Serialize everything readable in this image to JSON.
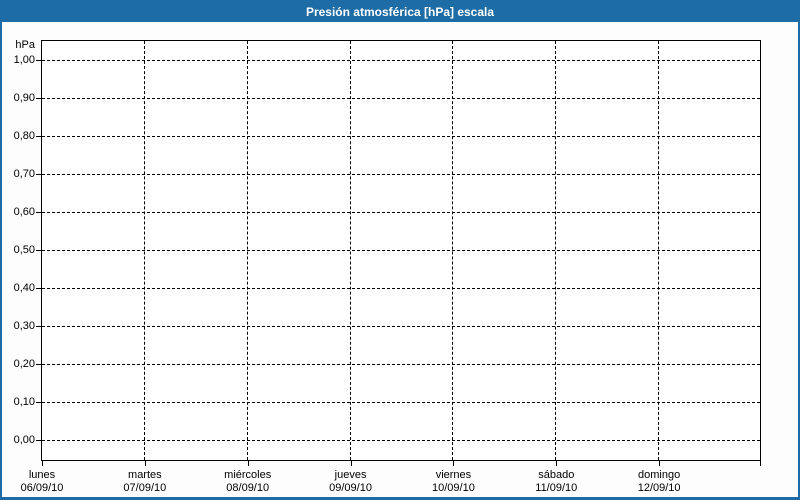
{
  "window": {
    "title": "Presión atmosférica [hPa] escala",
    "colors": {
      "accent": "#1E6CA5",
      "background": "#FCFDFC",
      "plot_background": "#FFFFFF",
      "grid": "#000000",
      "text": "#000000",
      "title_text": "#FFFFFF"
    }
  },
  "chart_data": {
    "type": "line",
    "title": "Presión atmosférica [hPa] escala",
    "xlabel": "",
    "ylabel": "hPa",
    "ylim": [
      0.0,
      1.0
    ],
    "y_step": 0.1,
    "y_tick_labels": [
      "1,00",
      "0,90",
      "0,80",
      "0,70",
      "0,60",
      "0,50",
      "0,40",
      "0,30",
      "0,20",
      "0,10",
      "0,00"
    ],
    "decimal_separator": ",",
    "grid": "dashed",
    "legend": "none",
    "x_categories": [
      {
        "name": "lunes",
        "date": "06/09/10"
      },
      {
        "name": "martes",
        "date": "07/09/10"
      },
      {
        "name": "miércoles",
        "date": "08/09/10"
      },
      {
        "name": "jueves",
        "date": "09/09/10"
      },
      {
        "name": "viernes",
        "date": "10/09/10"
      },
      {
        "name": "sábado",
        "date": "11/09/10"
      },
      {
        "name": "domingo",
        "date": "12/09/10"
      }
    ],
    "series": []
  }
}
